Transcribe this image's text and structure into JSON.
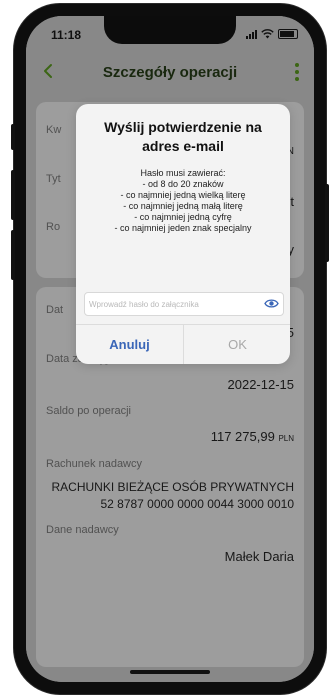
{
  "status_bar": {
    "time": "11:18"
  },
  "header": {
    "title": "Szczegóły operacji",
    "back_icon": "chevron-left-icon",
    "menu_icon": "kebab-menu-icon"
  },
  "card1": {
    "label_amount": "Kw",
    "value_amount_currency": "PLN",
    "label_title": "Tyt",
    "value_title": "est",
    "label_type": "Ro",
    "value_type": "ący"
  },
  "card2": {
    "label_date": "Dat",
    "value_date": "2022-12-15",
    "label_booking_date": "Data zaksięgowania",
    "value_booking_date": "2022-12-15",
    "label_balance": "Saldo po operacji",
    "value_balance_int": "117 275,99",
    "value_balance_currency": "PLN",
    "label_sender_account": "Rachunek nadawcy",
    "value_sender_account_name": "RACHUNKI BIEŻĄCE OSÓB PRYWATNYCH",
    "value_sender_account_number": "52 8787 0000 0000 0044 3000 0010",
    "label_sender_data": "Dane nadawcy",
    "value_sender_data": "Małek Daria"
  },
  "dialog": {
    "title": "Wyślij potwierdzenie na adres e-mail",
    "rules": [
      "Hasło musi zawierać:",
      "- od 8 do 20 znaków",
      "- co najmniej jedną wielką literę",
      "- co najmniej jedną małą literę",
      "- co najmniej jedną cyfrę",
      "- co najmniej jeden znak specjalny"
    ],
    "password_placeholder": "Wprowadź hasło do załącznika",
    "password_value": "",
    "cancel_label": "Anuluj",
    "ok_label": "OK",
    "eye_icon": "eye-icon"
  },
  "colors": {
    "accent_green": "#3f6b16",
    "link_blue": "#3b67b8",
    "disabled_gray": "#a8a8a8"
  }
}
